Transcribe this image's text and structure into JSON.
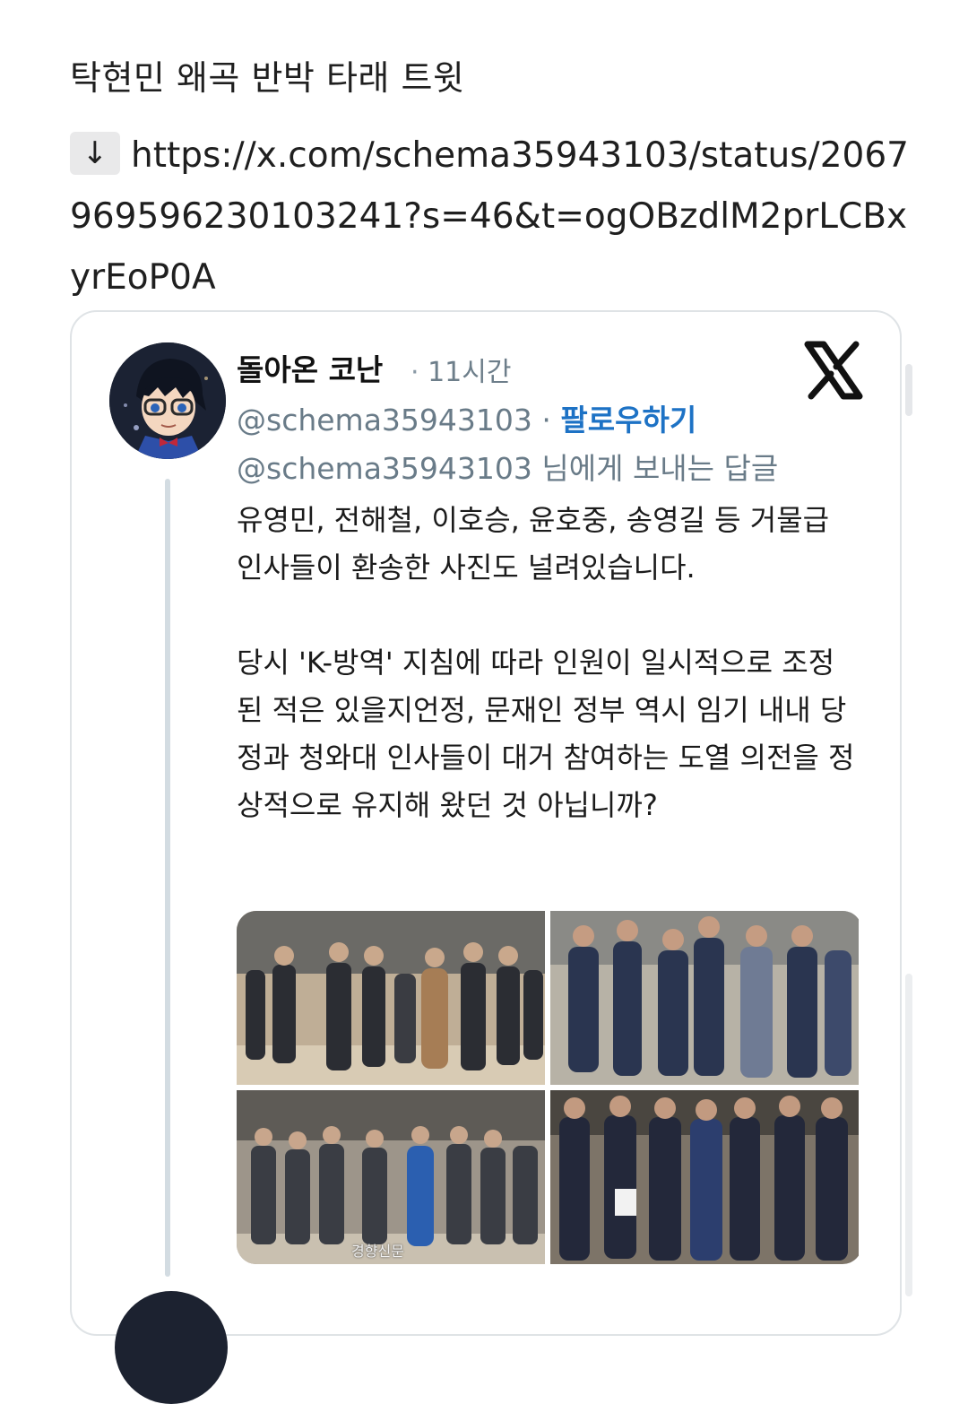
{
  "post": {
    "title": "탁현민 왜곡 반박 타래 트윗",
    "arrow": "↓",
    "url": "https://x.com/schema35943103/status/2067969596230103241?s=46&t=ogOBzdlM2prLCBxyrEoP0A"
  },
  "tweet": {
    "display_name": "돌아온 코난",
    "separator": "·",
    "time": "11시간",
    "handle": "@schema35943103",
    "follow_label": "팔로우하기",
    "reply_to": "@schema35943103 님에게 보내는 답글",
    "body": "유영민, 전해철, 이호승, 윤호중, 송영길 등 거물급 인사들이 환송한 사진도 널려있습니다.\n\n당시 'K-방역' 지침에 따라 인원이 일시적으로 조정된 적은 있을지언정, 문재인 정부 역시 임기 내내 당정과 청와대 인사들이 대거 참여하는 도열 의전을 정상적으로 유지해 왔던 것 아닙니까?",
    "photo_watermark": "경향신문"
  },
  "icons": {
    "platform": "x-logo-icon",
    "avatar": "conan-avatar"
  },
  "colors": {
    "follow_link": "#1d72c5",
    "secondary_text": "#697b88",
    "card_border": "#dfe3e6"
  }
}
